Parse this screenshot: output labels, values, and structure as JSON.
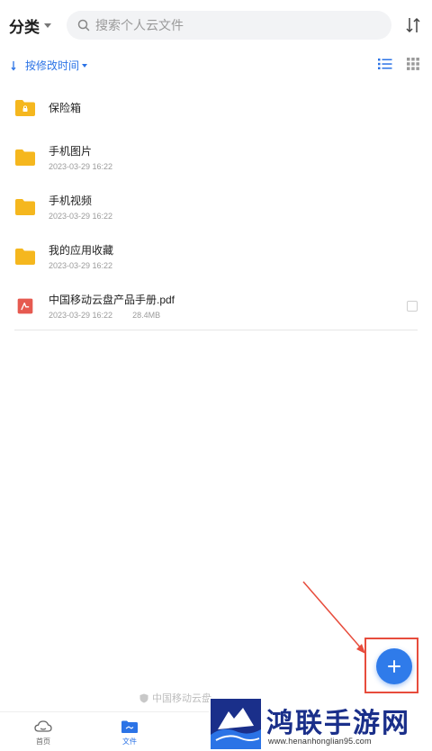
{
  "header": {
    "category_label": "分类",
    "search_placeholder": "搜索个人云文件"
  },
  "sortbar": {
    "label": "按修改时间"
  },
  "files": [
    {
      "name": "保险箱",
      "type": "vault"
    },
    {
      "name": "手机图片",
      "date": "2023-03-29 16:22",
      "type": "folder"
    },
    {
      "name": "手机视频",
      "date": "2023-03-29 16:22",
      "type": "folder"
    },
    {
      "name": "我的应用收藏",
      "date": "2023-03-29 16:22",
      "type": "folder"
    },
    {
      "name": "中国移动云盘产品手册.pdf",
      "date": "2023-03-29 16:22",
      "size": "28.4MB",
      "type": "pdf"
    }
  ],
  "footer_note": "中国移动云盘",
  "tabs": [
    {
      "label": "首页"
    },
    {
      "label": "文件",
      "active": true
    }
  ],
  "brand": {
    "name": "鸿联手游网",
    "url": "www.henanhonglian95.com"
  },
  "colors": {
    "accent": "#2b73e6",
    "folder": "#f5b71e",
    "pdf": "#e65a50",
    "highlight": "#e74c3c"
  }
}
